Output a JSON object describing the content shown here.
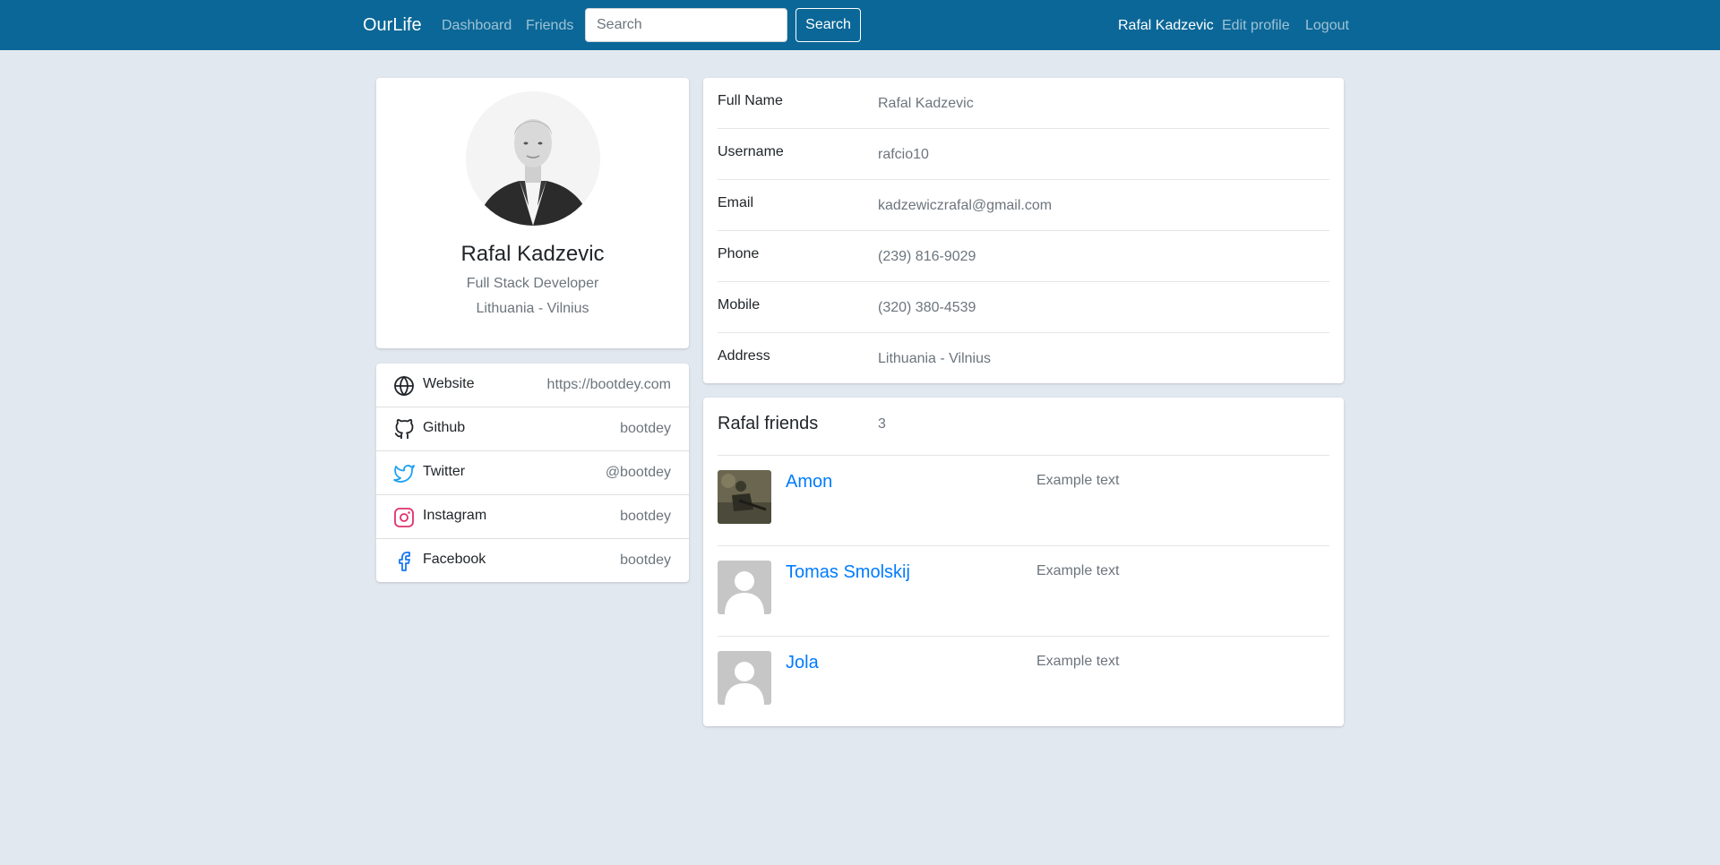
{
  "navbar": {
    "brand": "OurLife",
    "links": [
      "Dashboard",
      "Friends"
    ],
    "search_placeholder": "Search",
    "search_button": "Search",
    "user_name": "Rafal Kadzevic",
    "edit_profile": "Edit profile",
    "logout": "Logout",
    "color": "#0b6797"
  },
  "profile": {
    "name": "Rafal Kadzevic",
    "title": "Full Stack Developer",
    "location": "Lithuania - Vilnius"
  },
  "links": [
    {
      "label": "Website",
      "value": "https://bootdey.com",
      "icon": "globe-icon"
    },
    {
      "label": "Github",
      "value": "bootdey",
      "icon": "github-icon"
    },
    {
      "label": "Twitter",
      "value": "@bootdey",
      "icon": "twitter-icon",
      "color": "#1da1f2"
    },
    {
      "label": "Instagram",
      "value": "bootdey",
      "icon": "instagram-icon",
      "color": "#e1306c"
    },
    {
      "label": "Facebook",
      "value": "bootdey",
      "icon": "facebook-icon",
      "color": "#1877f2"
    }
  ],
  "info": [
    {
      "label": "Full Name",
      "value": "Rafal Kadzevic"
    },
    {
      "label": "Username",
      "value": "rafcio10"
    },
    {
      "label": "Email",
      "value": "kadzewiczrafal@gmail.com"
    },
    {
      "label": "Phone",
      "value": "(239) 816-9029"
    },
    {
      "label": "Mobile",
      "value": "(320) 380-4539"
    },
    {
      "label": "Address",
      "value": "Lithuania - Vilnius"
    }
  ],
  "friends": {
    "title": "Rafal friends",
    "count": "3",
    "items": [
      {
        "name": "Amon",
        "text": "Example text"
      },
      {
        "name": "Tomas Smolskij",
        "text": "Example text"
      },
      {
        "name": "Jola",
        "text": "Example text"
      }
    ]
  }
}
